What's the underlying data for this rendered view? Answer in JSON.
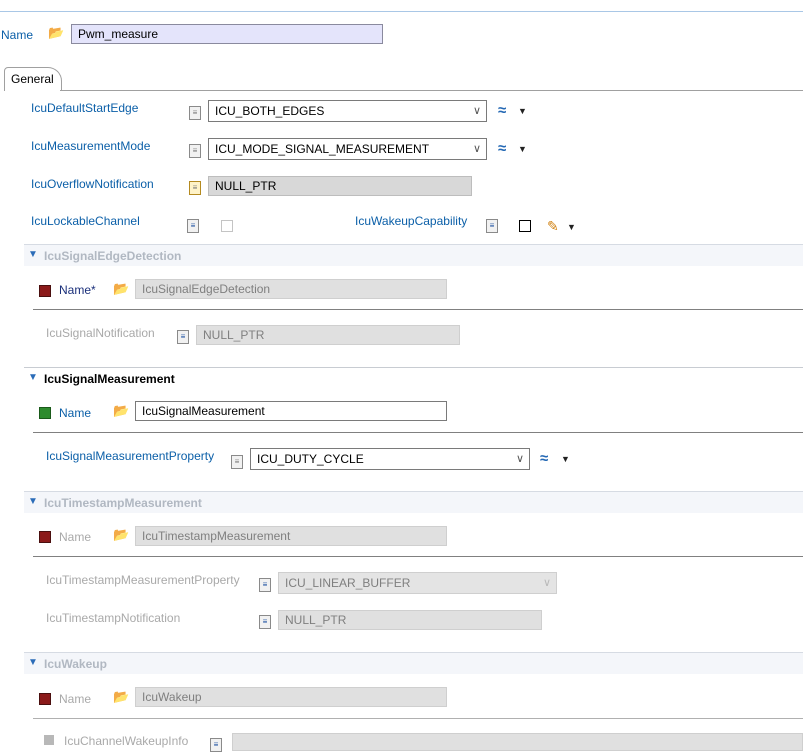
{
  "header": {
    "name_label": "Name",
    "name_value": "Pwm_measure"
  },
  "tabs": [
    {
      "label": "General"
    }
  ],
  "general": {
    "default_start_edge": {
      "label": "IcuDefaultStartEdge",
      "value": "ICU_BOTH_EDGES"
    },
    "measurement_mode": {
      "label": "IcuMeasurementMode",
      "value": "ICU_MODE_SIGNAL_MEASUREMENT"
    },
    "overflow_notification": {
      "label": "IcuOverflowNotification",
      "value": "NULL_PTR"
    },
    "lockable_channel": {
      "label": "IcuLockableChannel",
      "checked": false
    },
    "wakeup_capability": {
      "label": "IcuWakeupCapability",
      "checked": false
    }
  },
  "signal_edge_detection": {
    "title": "IcuSignalEdgeDetection",
    "name_label": "Name*",
    "name_value": "IcuSignalEdgeDetection",
    "notification_label": "IcuSignalNotification",
    "notification_value": "NULL_PTR"
  },
  "signal_measurement": {
    "title": "IcuSignalMeasurement",
    "name_label": "Name",
    "name_value": "IcuSignalMeasurement",
    "property_label": "IcuSignalMeasurementProperty",
    "property_value": "ICU_DUTY_CYCLE"
  },
  "timestamp_measurement": {
    "title": "IcuTimestampMeasurement",
    "name_label": "Name",
    "name_value": "IcuTimestampMeasurement",
    "property_label": "IcuTimestampMeasurementProperty",
    "property_value": "ICU_LINEAR_BUFFER",
    "notification_label": "IcuTimestampNotification",
    "notification_value": "NULL_PTR"
  },
  "wakeup": {
    "title": "IcuWakeup",
    "name_label": "Name",
    "name_value": "IcuWakeup",
    "channel_wakeup_label": "IcuChannelWakeupInfo",
    "channel_wakeup_value": ""
  },
  "icons": {
    "folder": "📂",
    "doc": "≡",
    "calc": "≈",
    "drop": "▼",
    "pencil": "✎",
    "tri": "▼",
    "arrow": "∨"
  }
}
